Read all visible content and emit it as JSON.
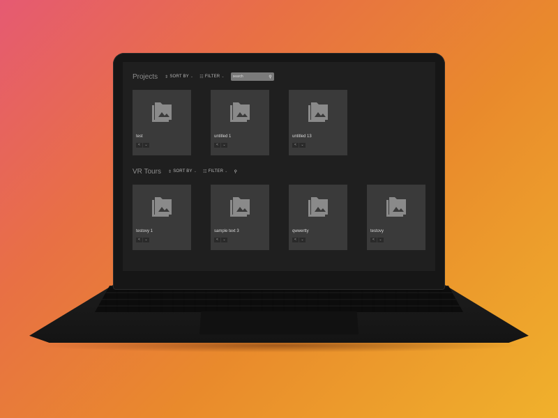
{
  "projects": {
    "title": "Projects",
    "sort_label": "SORT BY",
    "filter_label": "FILTER",
    "search_placeholder": "search",
    "items": [
      {
        "name": "test"
      },
      {
        "name": "untitled 1"
      },
      {
        "name": "untitled 13"
      }
    ]
  },
  "vr_tours": {
    "title": "VR Tours",
    "sort_label": "SORT BY",
    "filter_label": "FILTER",
    "items": [
      {
        "name": "testovy 1"
      },
      {
        "name": "sample text 3"
      },
      {
        "name": "qwwertty"
      },
      {
        "name": "testovy"
      }
    ]
  },
  "icons": {
    "sort": "sort-icon",
    "filter": "filter-icon",
    "search": "search-icon",
    "thumbnail": "image-folder-icon",
    "share": "share-icon",
    "more": "chevron-down-icon"
  },
  "colors": {
    "screen_bg": "#1f1f1f",
    "card_bg": "#3a3a3a",
    "icon": "#8a8a8a"
  }
}
